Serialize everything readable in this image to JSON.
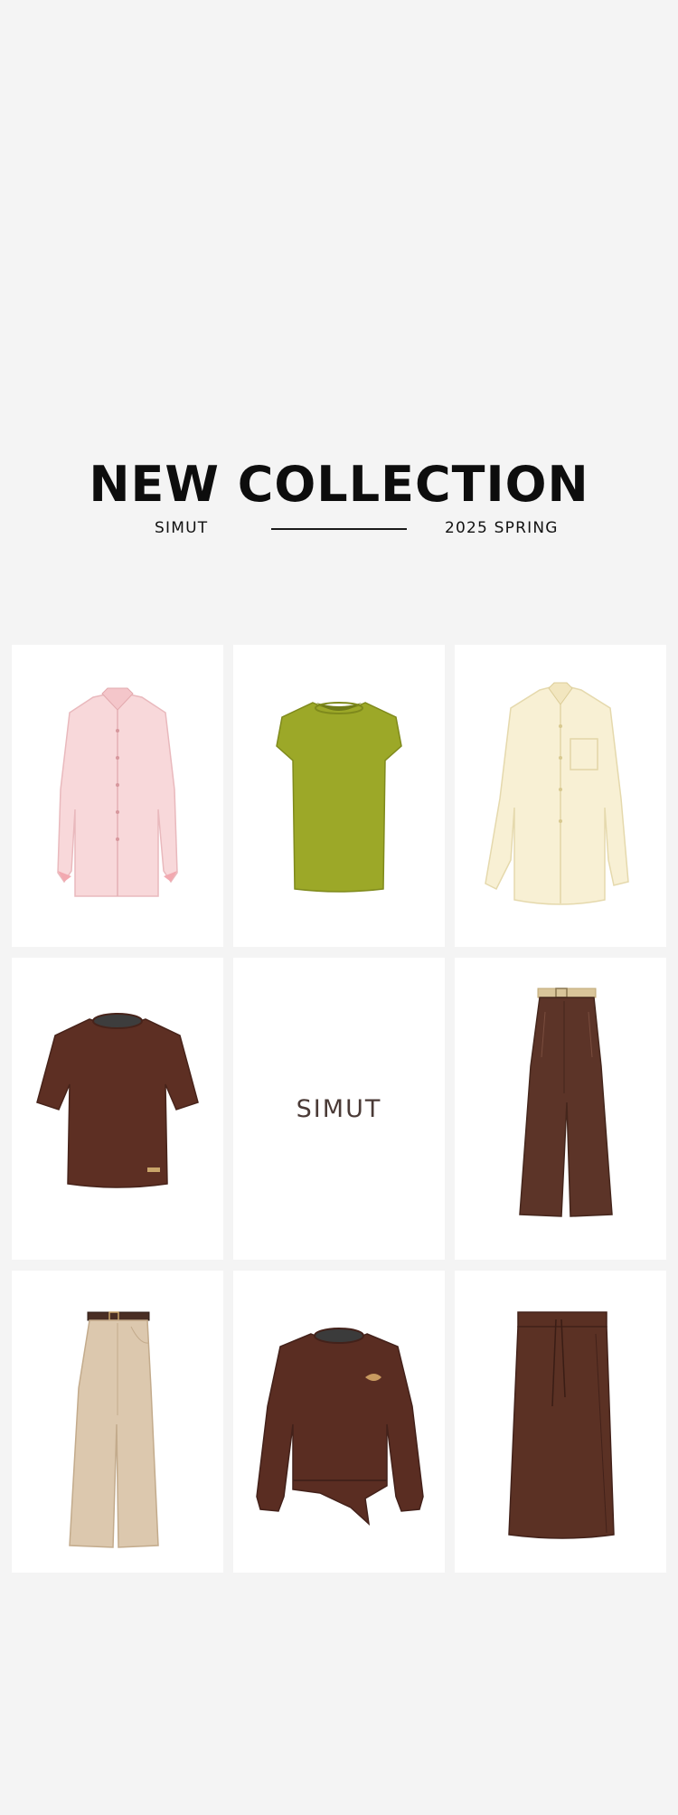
{
  "hero": {
    "title": "NEW COLLECTION",
    "brand": "SIMUT",
    "season": "2025 SPRING"
  },
  "grid": {
    "center_brand": "SIMUT",
    "items": [
      {
        "name": "pink-shirt",
        "color": "#f7d3d6"
      },
      {
        "name": "green-sleeveless-knit",
        "color": "#9aa625"
      },
      {
        "name": "cream-silk-shirt",
        "color": "#f7efcf"
      },
      {
        "name": "brown-tshirt",
        "color": "#5c2e22"
      },
      {
        "name": "brown-wide-trousers",
        "color": "#5b3428"
      },
      {
        "name": "beige-wide-trousers",
        "color": "#dcc7ae"
      },
      {
        "name": "brown-sweatshirt",
        "color": "#5a2c22"
      },
      {
        "name": "brown-midi-skirt",
        "color": "#5a3023"
      }
    ]
  }
}
